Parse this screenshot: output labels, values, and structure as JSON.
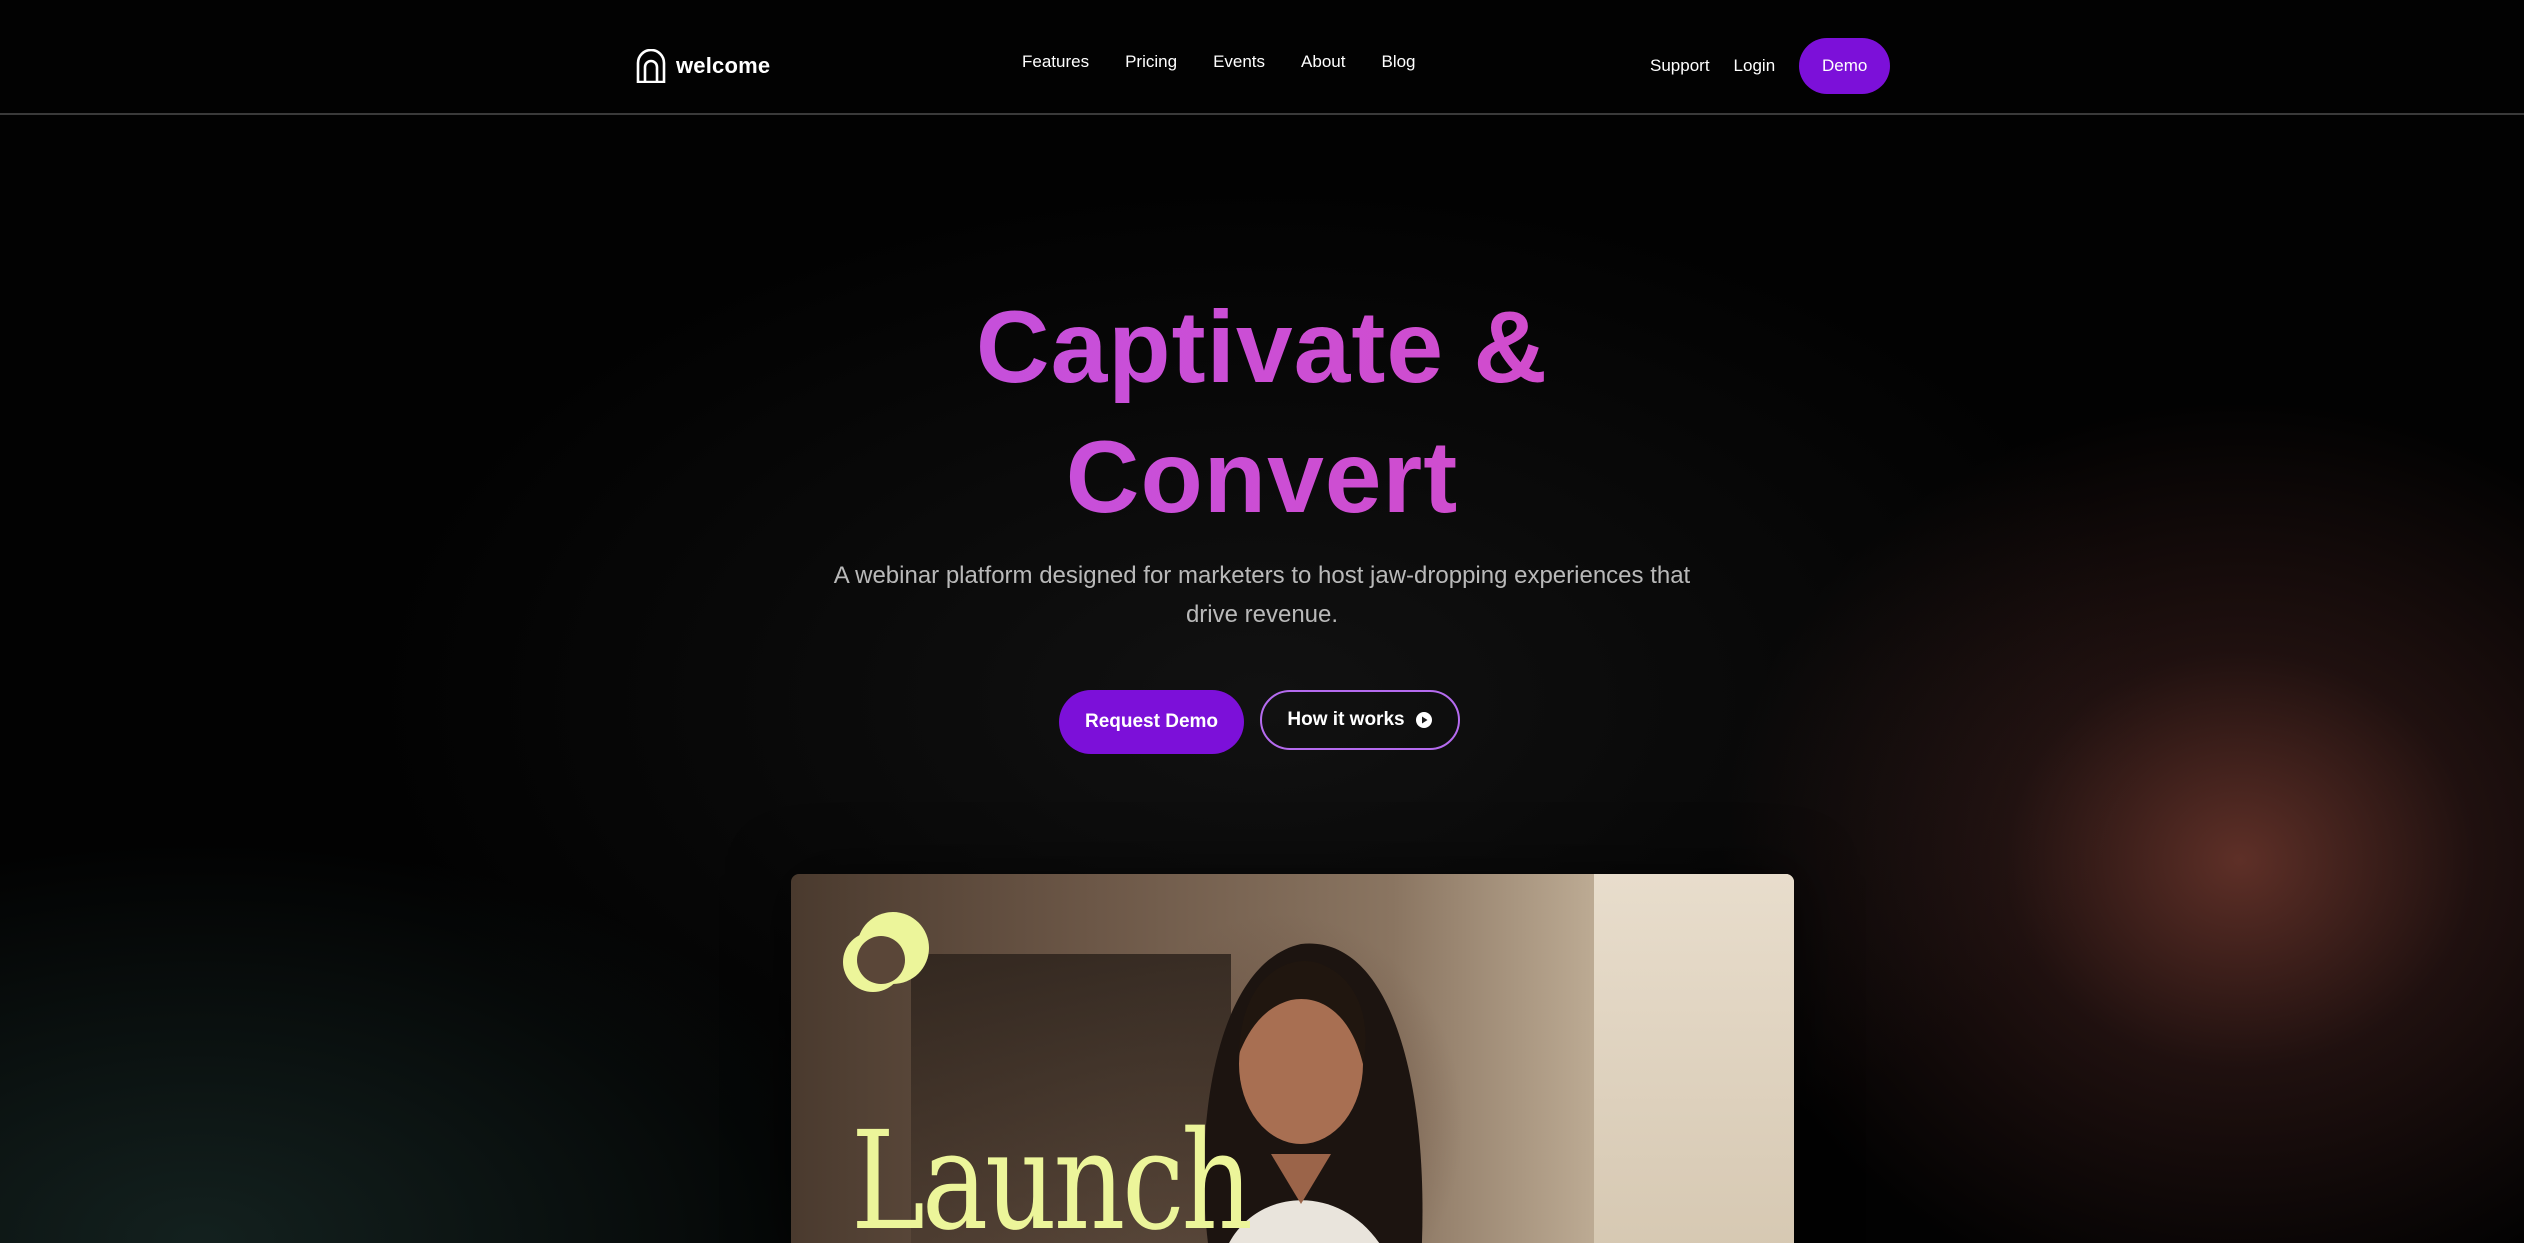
{
  "header": {
    "logo_text": "welcome",
    "nav": [
      "Features",
      "Pricing",
      "Events",
      "About",
      "Blog"
    ],
    "support": "Support",
    "login": "Login",
    "demo": "Demo"
  },
  "hero": {
    "title_line1": "Captivate &",
    "title_line2": "Convert",
    "subtitle": "A webinar platform designed for marketers to host jaw-dropping experiences that drive revenue.",
    "primary_cta": "Request Demo",
    "secondary_cta": "How it works"
  },
  "video": {
    "overlay_text": "Launch"
  },
  "colors": {
    "accent_purple": "#7c10d9",
    "outline_purple": "#b56bef",
    "title_gradient_start": "#b052ea",
    "title_gradient_end": "#e545b0",
    "launch_yellow": "#ecf59a"
  },
  "icons": {
    "logo": "arch-logo-icon",
    "play": "play-circle-icon",
    "brand_mark": "overlapping-circles-icon"
  }
}
